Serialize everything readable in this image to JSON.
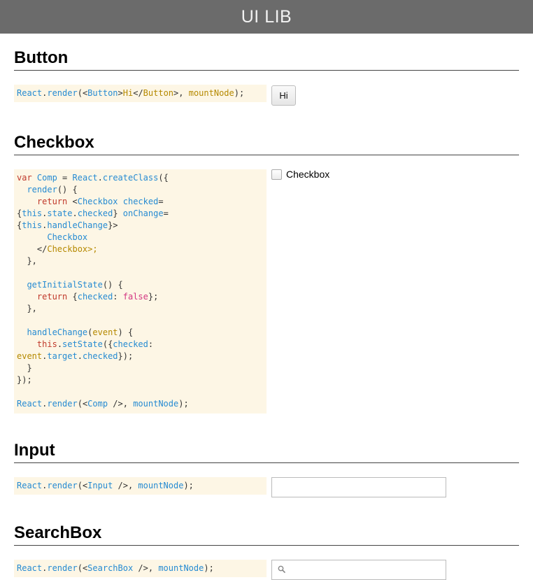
{
  "app": {
    "title": "UI LIB"
  },
  "sections": {
    "button": {
      "heading": "Button",
      "demo_label": "Hi"
    },
    "checkbox": {
      "heading": "Checkbox",
      "demo_label": "Checkbox",
      "checked": false
    },
    "input": {
      "heading": "Input",
      "value": "",
      "placeholder": ""
    },
    "searchbox": {
      "heading": "SearchBox",
      "value": "",
      "placeholder": "",
      "icon": "search-icon"
    }
  },
  "code_samples": {
    "button": [
      [
        [
          "blue",
          "React"
        ],
        [
          "plain",
          "."
        ],
        [
          "blue",
          "render"
        ],
        [
          "plain",
          "(<"
        ],
        [
          "blue",
          "Button"
        ],
        [
          "plain",
          ">"
        ],
        [
          "gold",
          "Hi"
        ],
        [
          "plain",
          "</"
        ],
        [
          "gold",
          "Button"
        ],
        [
          "plain",
          ">, "
        ],
        [
          "gold",
          "mountNode"
        ],
        [
          "plain",
          ");"
        ]
      ]
    ],
    "checkbox": [
      [
        [
          "kw",
          "var"
        ],
        [
          "plain",
          " "
        ],
        [
          "blue",
          "Comp"
        ],
        [
          "plain",
          " = "
        ],
        [
          "blue",
          "React"
        ],
        [
          "plain",
          "."
        ],
        [
          "blue",
          "createClass"
        ],
        [
          "plain",
          "({"
        ]
      ],
      [
        [
          "plain",
          "  "
        ],
        [
          "blue",
          "render"
        ],
        [
          "plain",
          "() {"
        ]
      ],
      [
        [
          "plain",
          "    "
        ],
        [
          "kw",
          "return"
        ],
        [
          "plain",
          " <"
        ],
        [
          "blue",
          "Checkbox"
        ],
        [
          "plain",
          " "
        ],
        [
          "blue",
          "checked"
        ],
        [
          "plain",
          "="
        ]
      ],
      [
        [
          "plain",
          "{"
        ],
        [
          "blue",
          "this"
        ],
        [
          "plain",
          "."
        ],
        [
          "blue",
          "state"
        ],
        [
          "plain",
          "."
        ],
        [
          "blue",
          "checked"
        ],
        [
          "plain",
          "} "
        ],
        [
          "blue",
          "onChange"
        ],
        [
          "plain",
          "="
        ]
      ],
      [
        [
          "plain",
          "{"
        ],
        [
          "blue",
          "this"
        ],
        [
          "plain",
          "."
        ],
        [
          "blue",
          "handleChange"
        ],
        [
          "plain",
          "}>"
        ]
      ],
      [
        [
          "plain",
          "      "
        ],
        [
          "blue",
          "Checkbox"
        ]
      ],
      [
        [
          "plain",
          "    </"
        ],
        [
          "gold",
          "Checkbox"
        ],
        [
          "gold",
          ">;"
        ]
      ],
      [
        [
          "plain",
          "  },"
        ]
      ],
      [
        [
          "plain",
          ""
        ]
      ],
      [
        [
          "plain",
          "  "
        ],
        [
          "blue",
          "getInitialState"
        ],
        [
          "plain",
          "() {"
        ]
      ],
      [
        [
          "plain",
          "    "
        ],
        [
          "kw",
          "return"
        ],
        [
          "plain",
          " {"
        ],
        [
          "blue",
          "checked"
        ],
        [
          "plain",
          ": "
        ],
        [
          "str",
          "false"
        ],
        [
          "plain",
          "};"
        ]
      ],
      [
        [
          "plain",
          "  },"
        ]
      ],
      [
        [
          "plain",
          ""
        ]
      ],
      [
        [
          "plain",
          "  "
        ],
        [
          "blue",
          "handleChange"
        ],
        [
          "plain",
          "("
        ],
        [
          "gold",
          "event"
        ],
        [
          "plain",
          ") {"
        ]
      ],
      [
        [
          "plain",
          "    "
        ],
        [
          "kw",
          "this"
        ],
        [
          "plain",
          "."
        ],
        [
          "blue",
          "setState"
        ],
        [
          "plain",
          "({"
        ],
        [
          "blue",
          "checked"
        ],
        [
          "plain",
          ":"
        ]
      ],
      [
        [
          "gold",
          "event"
        ],
        [
          "plain",
          "."
        ],
        [
          "blue",
          "target"
        ],
        [
          "plain",
          "."
        ],
        [
          "blue",
          "checked"
        ],
        [
          "plain",
          "});"
        ]
      ],
      [
        [
          "plain",
          "  }"
        ]
      ],
      [
        [
          "plain",
          "});"
        ]
      ],
      [
        [
          "plain",
          ""
        ]
      ],
      [
        [
          "blue",
          "React"
        ],
        [
          "plain",
          "."
        ],
        [
          "blue",
          "render"
        ],
        [
          "plain",
          "(<"
        ],
        [
          "blue",
          "Comp"
        ],
        [
          "plain",
          " />, "
        ],
        [
          "blue",
          "mountNode"
        ],
        [
          "plain",
          ");"
        ]
      ]
    ],
    "input": [
      [
        [
          "blue",
          "React"
        ],
        [
          "plain",
          "."
        ],
        [
          "blue",
          "render"
        ],
        [
          "plain",
          "(<"
        ],
        [
          "blue",
          "Input"
        ],
        [
          "plain",
          " />, "
        ],
        [
          "blue",
          "mountNode"
        ],
        [
          "plain",
          ");"
        ]
      ]
    ],
    "searchbox": [
      [
        [
          "blue",
          "React"
        ],
        [
          "plain",
          "."
        ],
        [
          "blue",
          "render"
        ],
        [
          "plain",
          "(<"
        ],
        [
          "blue",
          "SearchBox"
        ],
        [
          "plain",
          " />, "
        ],
        [
          "blue",
          "mountNode"
        ],
        [
          "plain",
          ");"
        ]
      ]
    ]
  }
}
